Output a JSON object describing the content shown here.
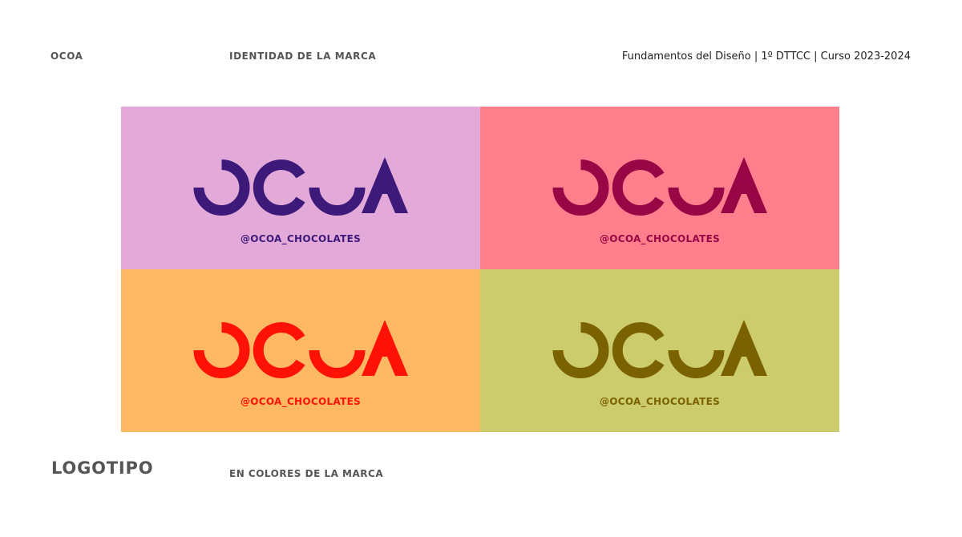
{
  "header": {
    "brand": "OCOA",
    "section": "IDENTIDAD DE LA MARCA",
    "course": "Fundamentos del Diseño | 1º DTTCC | Curso 2023-2024"
  },
  "logo_wordmark": "OCOA",
  "panels": [
    {
      "background": "#e3a9d9",
      "color": "#3d1a7a",
      "handle": "@OCOA_CHOCOLATES"
    },
    {
      "background": "#ff808c",
      "color": "#990645",
      "handle": "@OCOA_CHOCOLATES"
    },
    {
      "background": "#fdb863",
      "color": "#fe1207",
      "handle": "@OCOA_CHOCOLATES"
    },
    {
      "background": "#cdcc6d",
      "color": "#7a6200",
      "handle": "@OCOA_CHOCOLATES"
    }
  ],
  "footer": {
    "title": "LOGOTIPO",
    "subtitle": "EN COLORES DE LA MARCA"
  }
}
